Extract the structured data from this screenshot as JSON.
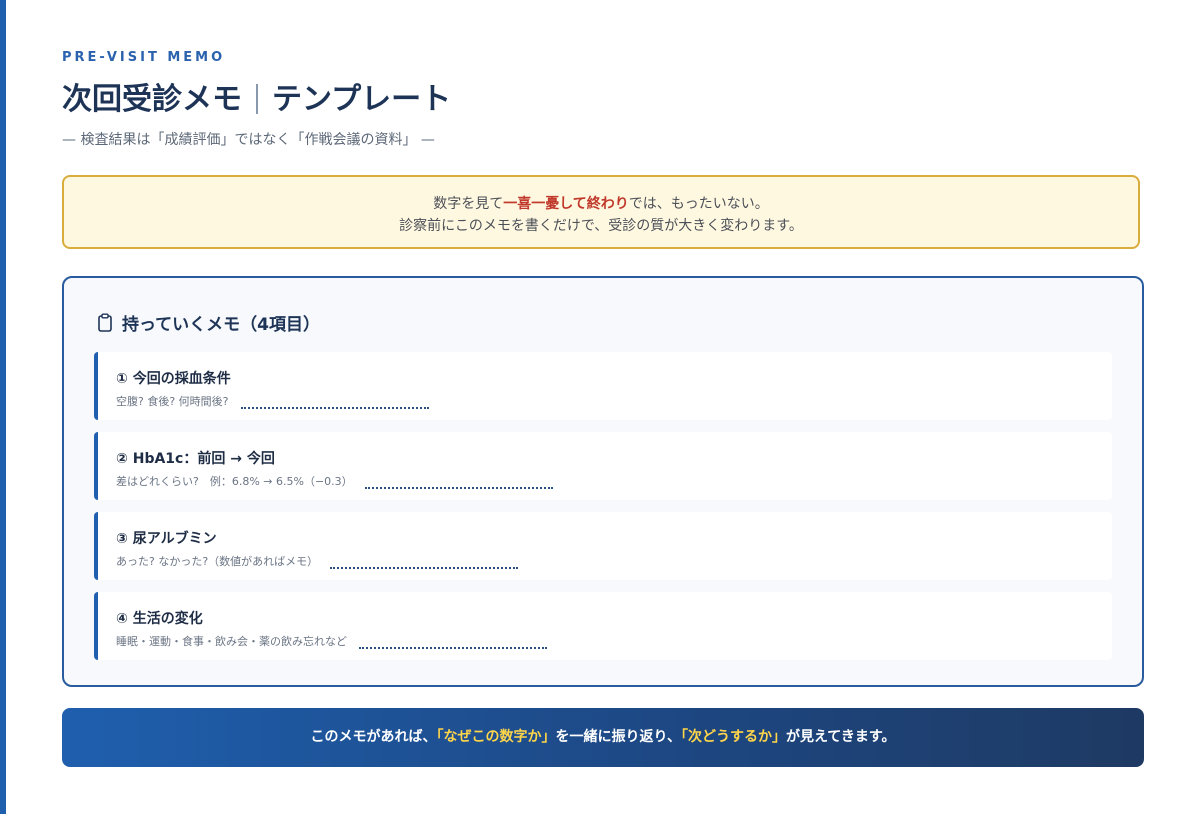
{
  "header": {
    "eyebrow": "PRE-VISIT MEMO",
    "title_main": "次回受診メモ",
    "title_sub": "テンプレート",
    "subtitle": "— 検査結果は「成績評価」ではなく「作戦会議の資料」 —"
  },
  "notice": {
    "line1_before": "数字を見て",
    "line1_em": "一喜一憂して終わり",
    "line1_after": "では、もったいない。",
    "line2": "診察前にこのメモを書くだけで、受診の質が大きく変わります。"
  },
  "memo": {
    "icon": "clipboard-icon",
    "heading": "持っていくメモ（4項目）",
    "items": [
      {
        "title": "① 今回の採血条件",
        "hint": "空腹? 食後? 何時間後?"
      },
      {
        "title": "② HbA1c：前回 → 今回",
        "hint": "差はどれくらい?　例：6.8% → 6.5%（−0.3）"
      },
      {
        "title": "③ 尿アルブミン",
        "hint": "あった? なかった?（数値があればメモ）"
      },
      {
        "title": "④ 生活の変化",
        "hint": "睡眠・運動・食事・飲み会・薬の飲み忘れなど"
      }
    ]
  },
  "footer": {
    "part1": "このメモがあれば、",
    "hl1": "「なぜこの数字か」",
    "part2": "を一緒に振り返り、",
    "hl2": "「次どうするか」",
    "part3": "が見えてきます。"
  },
  "colors": {
    "accent": "#1f5fae",
    "title": "#1e3457",
    "notice_bg": "#fff8e1",
    "notice_border": "#d9ad3c",
    "emphasis": "#c0392b",
    "highlight": "#ffd54a"
  }
}
